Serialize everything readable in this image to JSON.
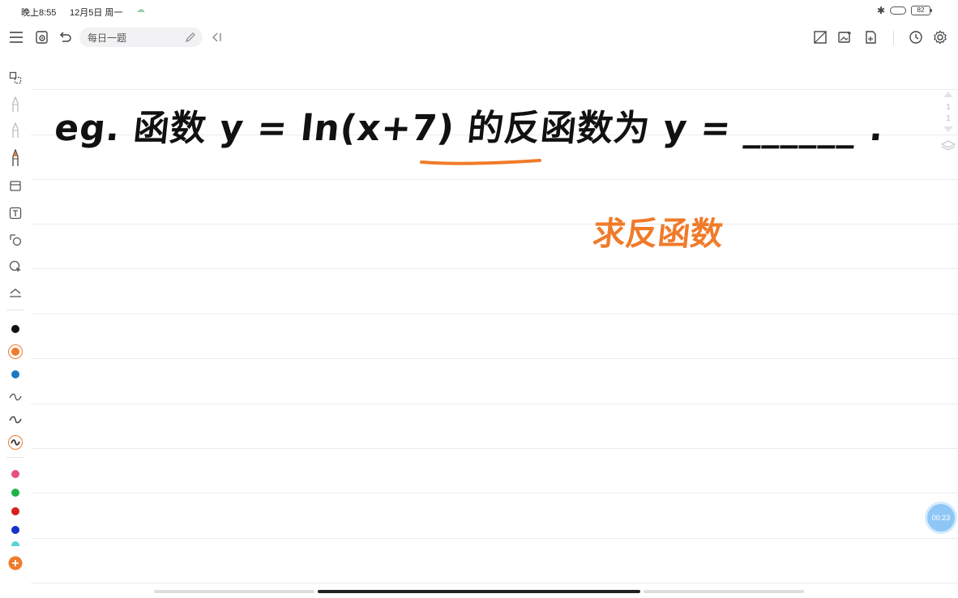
{
  "status": {
    "time": "晚上8:55",
    "date": "12月5日 周一",
    "battery": "82"
  },
  "toolbar": {
    "title": "每日一题"
  },
  "canvas": {
    "handwriting_line": "eg. 函数 y = ln(x+7) 的反函数为 y = ______ .",
    "annotation": "求反函数"
  },
  "page_rail": {
    "current": "1",
    "total": "1"
  },
  "recorder": {
    "timer": "00:23"
  },
  "colors": {
    "ink_black": "#111111",
    "ink_orange": "#f07b2a",
    "ink_blue": "#1a78c2",
    "pink": "#e8507c",
    "green": "#1fb24a",
    "red": "#d9211e",
    "navy": "#1731c9",
    "cyan": "#5fd3d3",
    "add": "#f07b2a"
  }
}
